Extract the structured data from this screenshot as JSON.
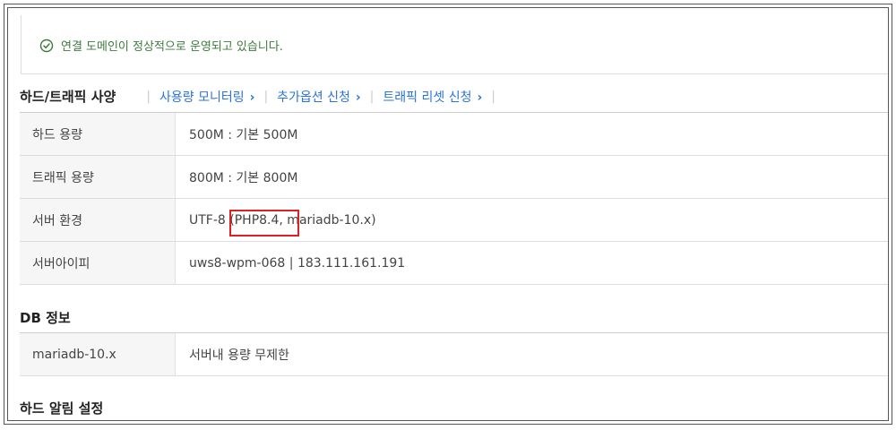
{
  "notice": {
    "text": "연결 도메인이 정상적으로 운영되고 있습니다."
  },
  "sections": {
    "hard_traffic": {
      "title": "하드/트래픽 사양",
      "tabs": [
        {
          "label": "사용량 모니터링"
        },
        {
          "label": "추가옵션 신청"
        },
        {
          "label": "트래픽 리셋 신청"
        }
      ],
      "rows": [
        {
          "label": "하드 용량",
          "value": "500M : 기본 500M"
        },
        {
          "label": "트래픽 용량",
          "value": "800M : 기본 800M"
        },
        {
          "label": "서버 환경",
          "value": "UTF-8 (PHP8.4, mariadb-10.x)"
        },
        {
          "label": "서버아이피",
          "value": "uws8-wpm-068 | 183.111.161.191"
        }
      ]
    },
    "db": {
      "title": "DB 정보",
      "rows": [
        {
          "label": "mariadb-10.x",
          "value": "서버내 용량 무제한"
        }
      ]
    },
    "hard_alert": {
      "title": "하드 알림 설정"
    }
  },
  "icons": {
    "check": "check-circle-icon",
    "chevron": "chevron-right-icon"
  },
  "colors": {
    "link": "#2a73d8",
    "success": "#3d7a3d",
    "highlight": "#e02020"
  }
}
